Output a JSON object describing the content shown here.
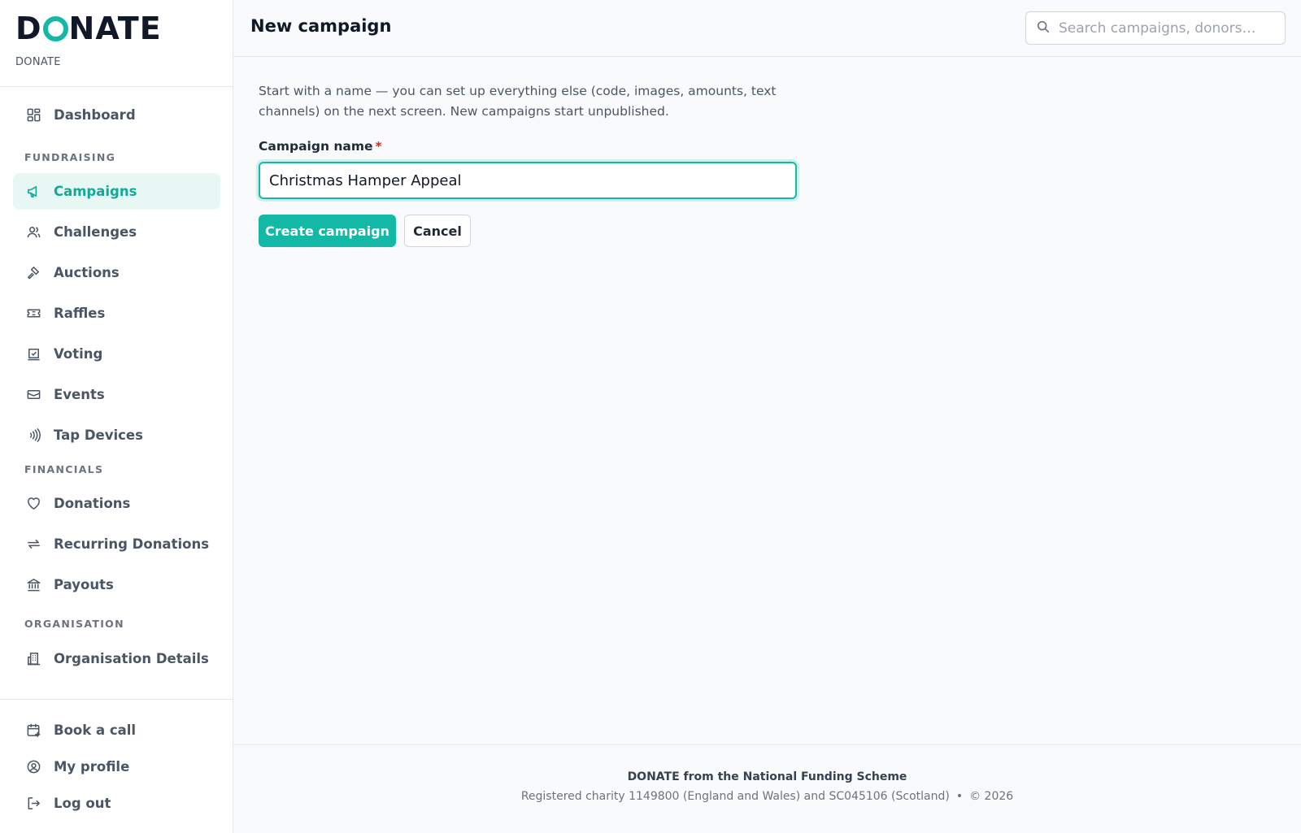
{
  "brand": {
    "logo_text_left": "D",
    "logo_text_right": "NATE",
    "logo_full": "DONATE",
    "org_name": "DONATE",
    "accent_color": "#14b8a6"
  },
  "sidebar": {
    "dashboard": {
      "label": "Dashboard",
      "icon": "dashboard-icon"
    },
    "sections": {
      "fundraising": "FUNDRAISING",
      "financials": "FINANCIALS",
      "organisation": "ORGANISATION"
    },
    "fundraising_items": [
      {
        "label": "Campaigns",
        "icon": "megaphone-icon",
        "active": true
      },
      {
        "label": "Challenges",
        "icon": "users-icon"
      },
      {
        "label": "Auctions",
        "icon": "gavel-icon"
      },
      {
        "label": "Raffles",
        "icon": "ticket-icon"
      },
      {
        "label": "Voting",
        "icon": "vote-icon"
      },
      {
        "label": "Events",
        "icon": "calendar-ticket-icon"
      },
      {
        "label": "Tap Devices",
        "icon": "contactless-icon"
      }
    ],
    "financial_items": [
      {
        "label": "Donations",
        "icon": "heart-icon"
      },
      {
        "label": "Recurring Donations",
        "icon": "repeat-icon"
      },
      {
        "label": "Payouts",
        "icon": "bank-icon"
      }
    ],
    "organisation_items": [
      {
        "label": "Organisation Details",
        "icon": "building-icon"
      }
    ],
    "bottom_items": [
      {
        "label": "Book a call",
        "icon": "calendar-plus-icon"
      },
      {
        "label": "My profile",
        "icon": "user-circle-icon"
      },
      {
        "label": "Log out",
        "icon": "logout-icon"
      }
    ]
  },
  "header": {
    "title": "New campaign",
    "search_placeholder": "Search campaigns, donors…"
  },
  "form": {
    "intro": "Start with a name — you can set up everything else (code, images, amounts, text channels) on the next screen. New campaigns start unpublished.",
    "field_label": "Campaign name",
    "required_mark": "*",
    "field_value": "Christmas Hamper Appeal",
    "submit_label": "Create campaign",
    "cancel_label": "Cancel"
  },
  "footer": {
    "title": "DONATE from the National Funding Scheme",
    "registration": "Registered charity 1149800 (England and Wales) and SC045106 (Scotland)",
    "separator": "•",
    "copyright": "© 2026"
  }
}
